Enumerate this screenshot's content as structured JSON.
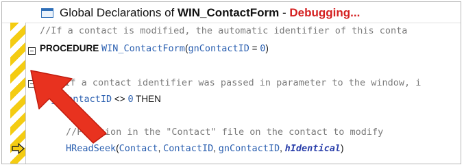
{
  "window": {
    "title_prefix": "Global Declarations of ",
    "title_name": "WIN_ContactForm",
    "title_sep": " - ",
    "title_status": "Debugging..."
  },
  "code": {
    "line1_comment": "//If a contact is modified, the automatic identifier of this conta",
    "line2_kw": "PROCEDURE ",
    "line2_name": "WIN_ContactForm",
    "line2_open": "(",
    "line2_param": "gnContactID",
    "line2_eq": " = ",
    "line2_val": "0",
    "line2_close": ")",
    "line3_comment": "//If a contact identifier was passed in parameter to the window, i",
    "line4_kw": "IF ",
    "line4_var": "gnContactID",
    "line4_op": " <> ",
    "line4_val": "0",
    "line4_then": " THEN",
    "line5_comment": "//Position in the \"Contact\" file on the contact to modify",
    "line6_func": "HReadSeek",
    "line6_open": "(",
    "line6_arg1": "Contact",
    "line6_sep1": ", ",
    "line6_arg2": "ContactID",
    "line6_sep2": ", ",
    "line6_arg3": "gnContactID",
    "line6_sep3": ", ",
    "line6_arg4": "hIdentical",
    "line6_close": ")"
  },
  "colors": {
    "debug_status": "#d42020",
    "gutter_stripe": "#f4cc12",
    "identifier": "#2a5fb0",
    "comment": "#7b7b7b",
    "annotation_arrow": "#e8321f"
  },
  "icons": [
    "window-icon",
    "fold-collapse-icon",
    "current-line-arrow-icon",
    "annotation-arrow-icon"
  ]
}
